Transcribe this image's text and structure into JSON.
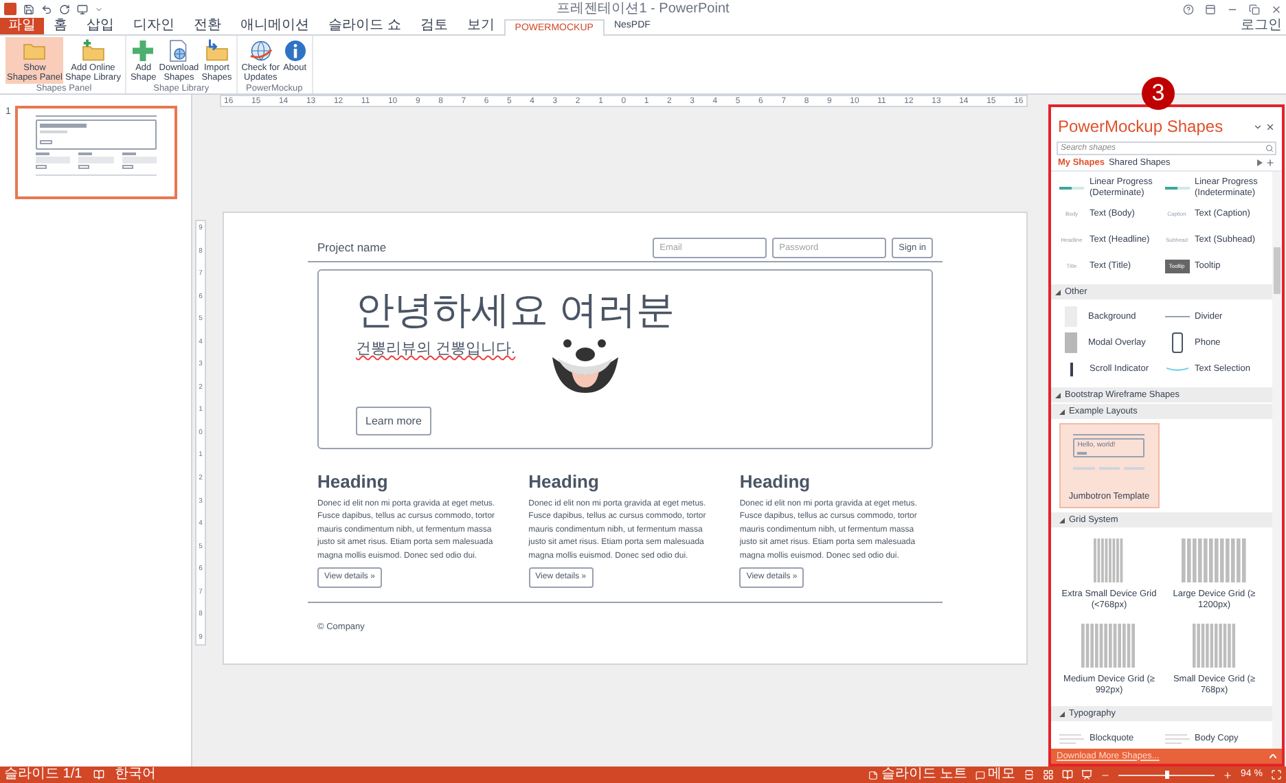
{
  "window": {
    "title": "프레젠테이션1 - PowerPoint",
    "account": "로그인"
  },
  "tabs": [
    {
      "label": "파일",
      "kind": "file",
      "selected": false
    },
    {
      "label": "홈",
      "kind": "tab",
      "selected": false
    },
    {
      "label": "삽입",
      "kind": "tab",
      "selected": false
    },
    {
      "label": "디자인",
      "kind": "tab",
      "selected": false
    },
    {
      "label": "전환",
      "kind": "tab",
      "selected": false
    },
    {
      "label": "애니메이션",
      "kind": "tab",
      "selected": false
    },
    {
      "label": "슬라이드 쇼",
      "kind": "tab",
      "selected": false
    },
    {
      "label": "검토",
      "kind": "tab",
      "selected": false
    },
    {
      "label": "보기",
      "kind": "tab",
      "selected": false
    },
    {
      "label": "POWERMOCKUP",
      "kind": "tab",
      "selected": true
    },
    {
      "label": "NesPDF",
      "kind": "tab",
      "selected": false
    }
  ],
  "ribbon": {
    "groups": [
      {
        "label": "Shapes Panel",
        "buttons": [
          {
            "label": "Show\nShapes Panel",
            "kind": "folder",
            "selected": true
          },
          {
            "label": "Add Online\nShape Library",
            "kind": "folderplus",
            "selected": false
          }
        ]
      },
      {
        "label": "Shape Library",
        "buttons": [
          {
            "label": "Add\nShape",
            "kind": "plus",
            "selected": false
          },
          {
            "label": "Download\nShapes",
            "kind": "document",
            "selected": false
          },
          {
            "label": "Import\nShapes",
            "kind": "import",
            "selected": false
          }
        ]
      },
      {
        "label": "PowerMockup",
        "buttons": [
          {
            "label": "Check for\nUpdates",
            "kind": "globe",
            "selected": false
          },
          {
            "label": "About",
            "kind": "info",
            "selected": false
          }
        ]
      }
    ]
  },
  "ruler": {
    "horizontal": [
      "16",
      "15",
      "14",
      "13",
      "12",
      "11",
      "10",
      "9",
      "8",
      "7",
      "6",
      "5",
      "4",
      "3",
      "2",
      "1",
      "0",
      "1",
      "2",
      "3",
      "4",
      "5",
      "6",
      "7",
      "8",
      "9",
      "10",
      "11",
      "12",
      "13",
      "14",
      "15",
      "16"
    ],
    "vertical": [
      "9",
      "8",
      "7",
      "6",
      "5",
      "4",
      "3",
      "2",
      "1",
      "0",
      "1",
      "2",
      "3",
      "4",
      "5",
      "6",
      "7",
      "8",
      "9"
    ]
  },
  "slides": [
    {
      "number": "1",
      "selected": true
    }
  ],
  "slide": {
    "brand": "Project name",
    "email_placeholder": "Email",
    "password_placeholder": "Password",
    "sign_in": "Sign in",
    "jumbotron": {
      "title": "안녕하세요 여러분",
      "subtitle": "건뽕리뷰의 건뽕입니다.",
      "misspelled": true,
      "button": "Learn more"
    },
    "columns": [
      {
        "heading": "Heading",
        "body": "Donec id elit non mi porta gravida at eget metus. Fusce dapibus, tellus ac cursus commodo, tortor mauris condimentum nibh, ut fermentum massa justo sit amet risus. Etiam porta sem malesuada magna mollis euismod. Donec sed odio dui.",
        "button": "View details »"
      },
      {
        "heading": "Heading",
        "body": "Donec id elit non mi porta gravida at eget metus. Fusce dapibus, tellus ac cursus commodo, tortor mauris condimentum nibh, ut fermentum massa justo sit amet risus. Etiam porta sem malesuada magna mollis euismod. Donec sed odio dui.",
        "button": "View details »"
      },
      {
        "heading": "Heading",
        "body": "Donec id elit non mi porta gravida at eget metus. Fusce dapibus, tellus ac cursus commodo, tortor mauris condimentum nibh, ut fermentum massa justo sit amet risus. Etiam porta sem malesuada magna mollis euismod. Donec sed odio dui.",
        "button": "View details »"
      }
    ],
    "footer": "© Company"
  },
  "panel": {
    "badge": "3",
    "title": "PowerMockup Shapes",
    "search_placeholder": "Search shapes",
    "tabs": [
      {
        "label": "My Shapes",
        "selected": true
      },
      {
        "label": "Shared Shapes",
        "selected": false
      }
    ],
    "groups": [
      {
        "items": [
          {
            "label": "Linear Progress\n(Determinate)",
            "kind": "progress"
          },
          {
            "label": "Linear Progress\n(Indeterminate)",
            "kind": "progress"
          },
          {
            "label": "Text (Body)",
            "kind": "sample",
            "sample": "Body"
          },
          {
            "label": "Text (Caption)",
            "kind": "sample",
            "sample": "Caption"
          },
          {
            "label": "Text (Headline)",
            "kind": "sample",
            "sample": "Headline"
          },
          {
            "label": "Text (Subhead)",
            "kind": "sample",
            "sample": "Subhead"
          },
          {
            "label": "Text (Title)",
            "kind": "sample",
            "sample": "Title"
          },
          {
            "label": "Tooltip",
            "kind": "tooltip",
            "sample": "Tooltip"
          }
        ]
      },
      {
        "title": "Other",
        "expanded": true,
        "items": [
          {
            "label": "Background",
            "kind": "background"
          },
          {
            "label": "Divider",
            "kind": "divider"
          },
          {
            "label": "Modal Overlay",
            "kind": "modal"
          },
          {
            "label": "Phone",
            "kind": "phone"
          },
          {
            "label": "Scroll Indicator",
            "kind": "scroll"
          },
          {
            "label": "Text Selection",
            "kind": "selection"
          }
        ]
      },
      {
        "title": "Bootstrap Wireframe Shapes",
        "expanded": true,
        "children": [
          {
            "title": "Example Layouts",
            "expanded": true,
            "tiles": [
              {
                "label": "Jumbotron Template",
                "kind": "jumbotron",
                "sample": "Hello, world!",
                "selected": true
              }
            ]
          },
          {
            "title": "Grid System",
            "expanded": true,
            "tiles": [
              {
                "label": "Extra Small Device Grid (<768px)",
                "kind": "grid",
                "selected": false
              },
              {
                "label": "Large Device Grid (≥ 1200px)",
                "kind": "grid",
                "selected": false
              },
              {
                "label": "Medium Device Grid (≥ 992px)",
                "kind": "grid",
                "selected": false
              },
              {
                "label": "Small Device Grid (≥ 768px)",
                "kind": "grid",
                "selected": false
              }
            ]
          },
          {
            "title": "Typography",
            "expanded": true,
            "items": [
              {
                "label": "Blockquote",
                "kind": "lines"
              },
              {
                "label": "Body Copy",
                "kind": "lines"
              }
            ]
          }
        ]
      }
    ],
    "footer": "Download More Shapes..."
  },
  "status_bar": {
    "slide": "슬라이드 1/1",
    "language": "한국어",
    "notes": "슬라이드 노트",
    "comments": "메모",
    "zoom": {
      "level": 0.5,
      "reading": "94 %"
    }
  }
}
